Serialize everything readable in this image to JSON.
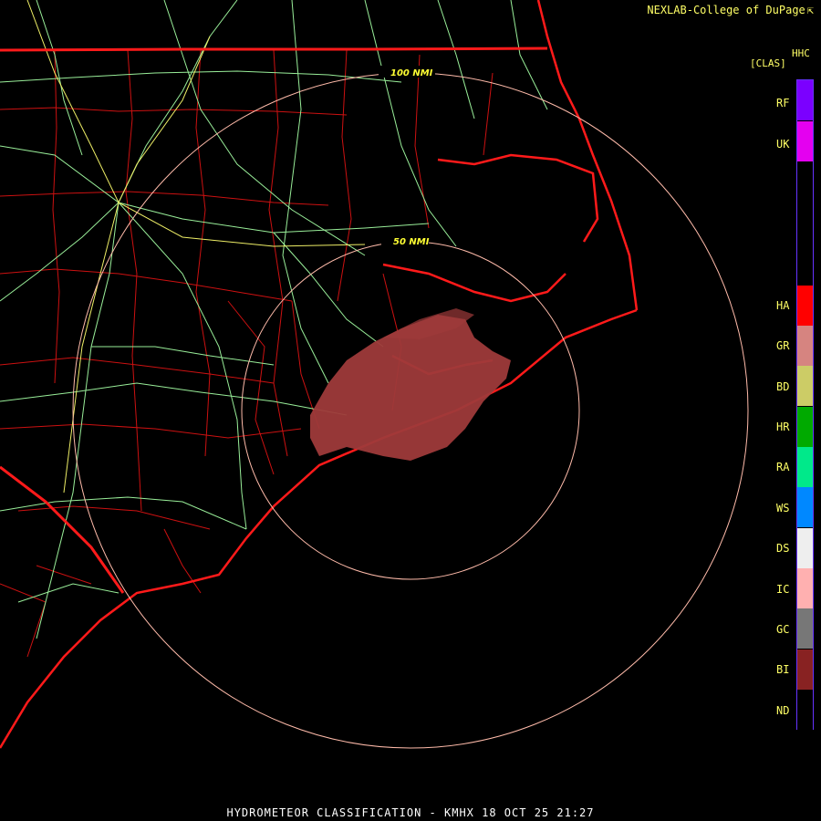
{
  "credit": "NEXLAB-College of DuPage",
  "credit_icon": "cursor-arrow-icon",
  "legend": {
    "title": "HHC",
    "product": "[CLAS]",
    "categories": [
      {
        "code": "RF",
        "color": "#7b00ff"
      },
      {
        "code": "UK",
        "color": "#e400f0"
      },
      {
        "code": "HA",
        "color": "#ff0000"
      },
      {
        "code": "GR",
        "color": "#d68480"
      },
      {
        "code": "BD",
        "color": "#cccc66"
      },
      {
        "code": "HR",
        "color": "#00aa00"
      },
      {
        "code": "RA",
        "color": "#00e98a"
      },
      {
        "code": "WS",
        "color": "#0088ff"
      },
      {
        "code": "DS",
        "color": "#eeeeee"
      },
      {
        "code": "IC",
        "color": "#ffb0b0"
      },
      {
        "code": "GC",
        "color": "#777777"
      },
      {
        "code": "BI",
        "color": "#882222"
      },
      {
        "code": "ND",
        "color": "#000000"
      }
    ]
  },
  "range_rings": [
    {
      "label": "50 NMI"
    },
    {
      "label": "100 NMI"
    }
  ],
  "footer": "HYDROMETEOR CLASSIFICATION - KMHX 18 OCT 25 21:27",
  "colors": {
    "state_border": "#ff1a1a",
    "county_border": "#cc1111",
    "roads": "#99ee99",
    "interstates": "#eeee66",
    "ring": "#ffbbaa",
    "echo": "#9e3a3a"
  }
}
